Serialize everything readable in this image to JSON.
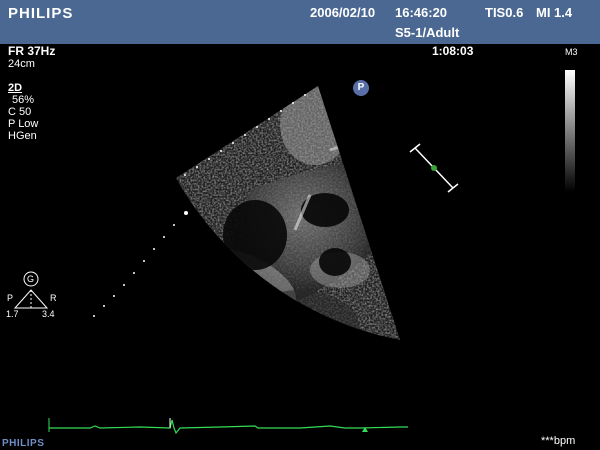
{
  "header": {
    "brand": "PHILIPS",
    "date": "2006/02/10",
    "time": "16:46:20",
    "tis": "TIS0.6",
    "mi": "MI 1.4",
    "probe": "S5-1/Adult"
  },
  "left_panel": {
    "frame_rate": "FR 37Hz",
    "depth": "24cm",
    "mode": "2D",
    "gain": "56%",
    "compression": "C 50",
    "power": "P Low",
    "harmonics": "HGen"
  },
  "clip_time": "1:08:03",
  "gray_map": "M3",
  "focus_badge": "P",
  "orientation": {
    "badge": "G",
    "left": "P",
    "right": "R",
    "left_value": "1.7",
    "right_value": "3.4"
  },
  "footer": {
    "brand": "PHILIPS",
    "heart_rate": "***bpm"
  },
  "colors": {
    "header_bg": "#4a6892",
    "ecg_trace": "#33dd55",
    "focus_marker": "#3aa33a"
  }
}
